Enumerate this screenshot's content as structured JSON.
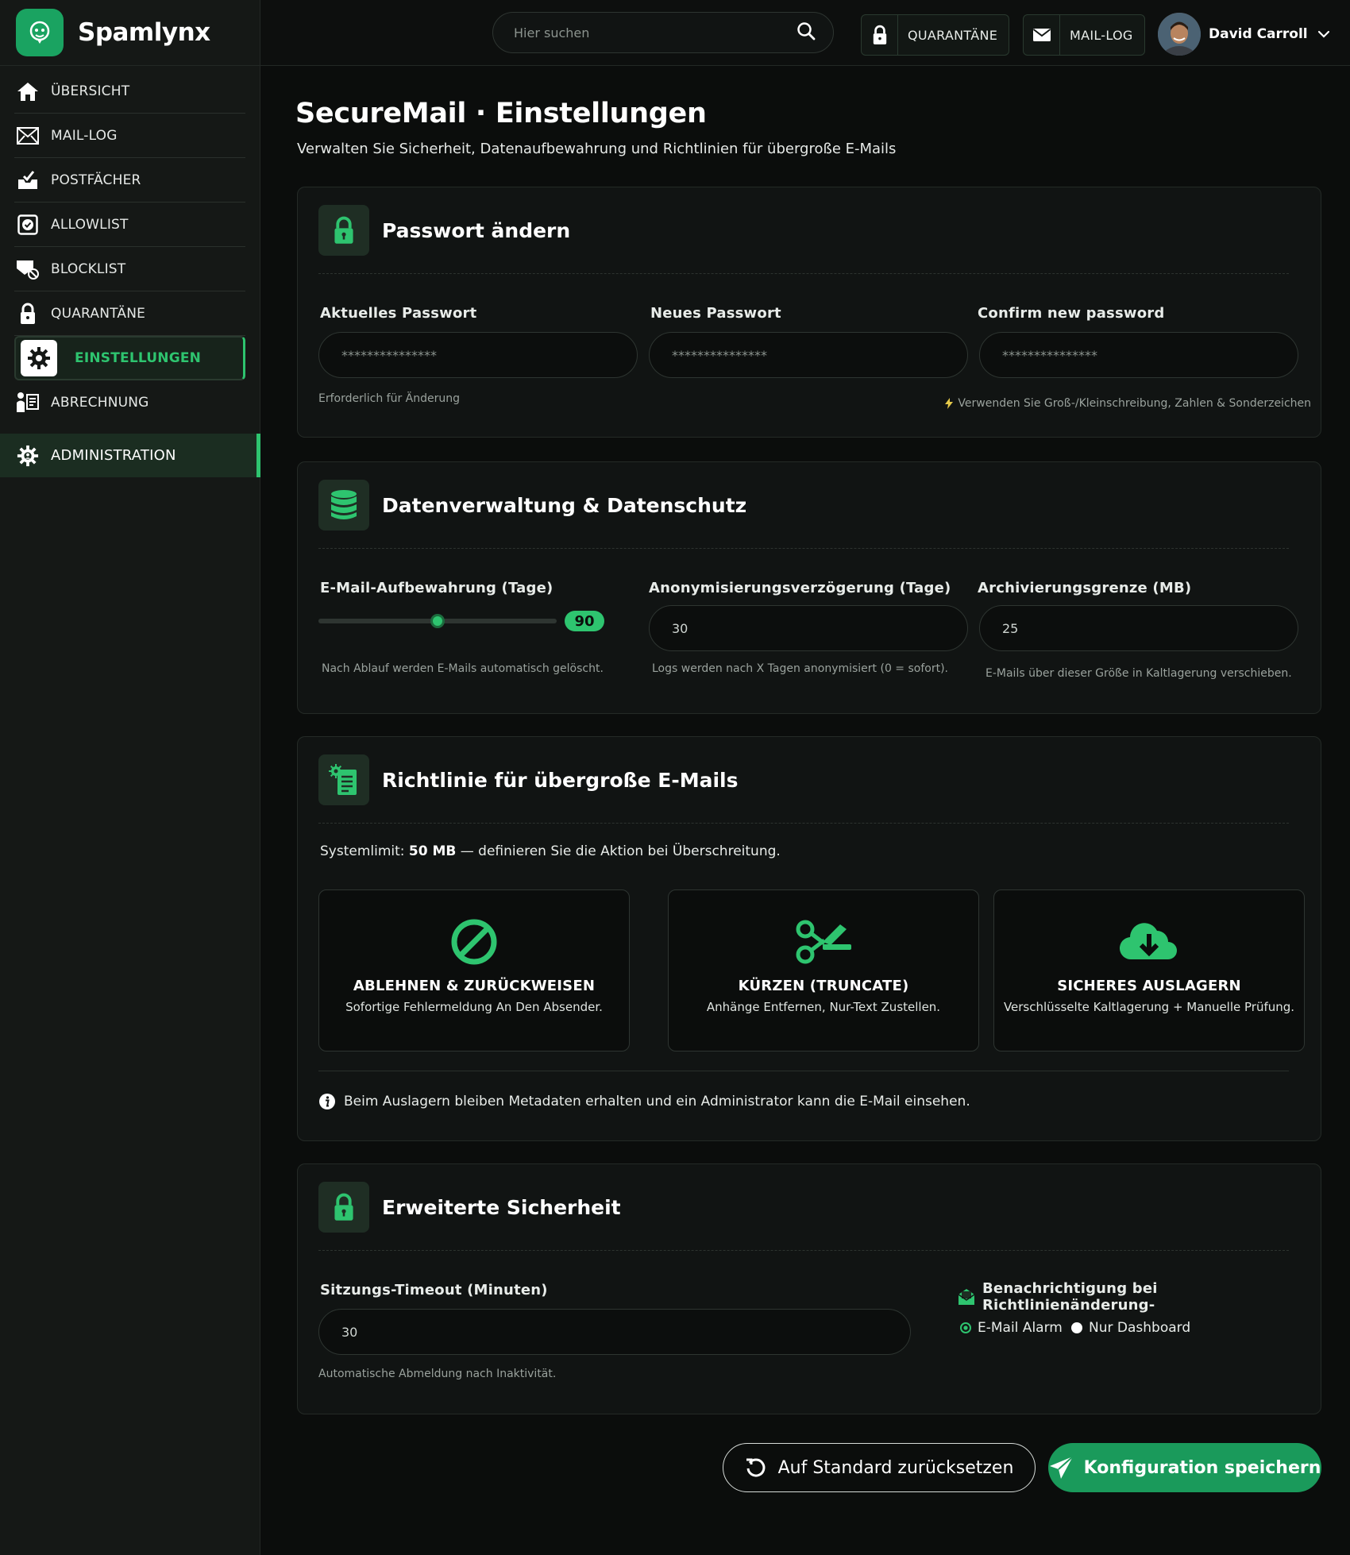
{
  "brand": {
    "name": "Spamlynx"
  },
  "colors": {
    "accent": "#2ec46f",
    "accent_dark": "#1a9a5b",
    "background": "#0b0d0c",
    "card": "#111413"
  },
  "sidebar": {
    "items": [
      {
        "label": "ÜBERSICHT",
        "icon": "home-icon"
      },
      {
        "label": "MAIL-LOG",
        "icon": "mail-log-icon"
      },
      {
        "label": "POSTFÄCHER",
        "icon": "inbox-icon"
      },
      {
        "label": "ALLOWLIST",
        "icon": "check-square-icon"
      },
      {
        "label": "BLOCKLIST",
        "icon": "mail-block-icon"
      },
      {
        "label": "QUARANTÄNE",
        "icon": "lock-icon"
      },
      {
        "label": "EINSTELLUNGEN",
        "icon": "gear-icon",
        "active": true
      },
      {
        "label": "ABRECHNUNG",
        "icon": "billing-icon"
      }
    ],
    "admin": {
      "label": "ADMINISTRATION",
      "icon": "admin-gear-icon"
    }
  },
  "topbar": {
    "search_placeholder": "Hier suchen",
    "quarantine_label": "QUARANTÄNE",
    "maillog_label": "MAIL-LOG",
    "user_name": "David Carroll"
  },
  "page": {
    "title": "SecureMail · Einstellungen",
    "subtitle": "Verwalten Sie Sicherheit, Datenaufbewahrung und Richtlinien für übergroße E-Mails"
  },
  "password": {
    "title": "Passwort ändern",
    "current_label": "Aktuelles Passwort",
    "new_label": "Neues Passwort",
    "confirm_label": "Confirm new password",
    "mask": "***************",
    "hint_required": "Erforderlich für Änderung",
    "hint_rules": "Verwenden Sie Groß-/Kleinschreibung, Zahlen & Sonderzeichen"
  },
  "data_mgmt": {
    "title": "Datenverwaltung & Datenschutz",
    "retention_label": "E-Mail-Aufbewahrung (Tage)",
    "retention_value": 90,
    "retention_min": 0,
    "retention_max": 180,
    "retention_hint": "Nach Ablauf werden E-Mails automatisch gelöscht.",
    "anon_label": "Anonymisierungsverzögerung (Tage)",
    "anon_value": "30",
    "anon_hint": "Logs werden nach X Tagen anonymisiert (0 = sofort).",
    "archive_label": "Archivierungsgrenze (MB)",
    "archive_value": "25",
    "archive_hint": "E-Mails über dieser Größe in Kaltlagerung verschieben."
  },
  "oversize": {
    "title": "Richtlinie für übergroße E-Mails",
    "limit_prefix": "Systemlimit: ",
    "limit_value": "50 MB",
    "limit_suffix": " — definieren Sie die Aktion bei Überschreitung.",
    "options": [
      {
        "title": "ABLEHNEN & ZURÜCKWEISEN",
        "desc": "Sofortige Fehlermeldung An Den Absender.",
        "icon": "ban-icon"
      },
      {
        "title": "KÜRZEN (TRUNCATE)",
        "desc": "Anhänge Entfernen, Nur-Text Zustellen.",
        "icon": "scissors-icon"
      },
      {
        "title": "SICHERES AUSLAGERN",
        "desc": "Verschlüsselte Kaltlagerung + Manuelle Prüfung.",
        "icon": "cloud-download-icon"
      }
    ],
    "info": "Beim Auslagern bleiben Metadaten erhalten und ein Administrator kann die E-Mail einsehen."
  },
  "advanced": {
    "title": "Erweiterte Sicherheit",
    "timeout_label": "Sitzungs-Timeout (Minuten)",
    "timeout_value": "30",
    "timeout_hint": "Automatische Abmeldung nach Inaktivität.",
    "notify_label": "Benachrichtigung bei Richtlinienänderung-",
    "radio_email": "E-Mail Alarm",
    "radio_dashboard": "Nur Dashboard"
  },
  "actions": {
    "reset_label": "Auf Standard zurücksetzen",
    "save_label": "Konfiguration speichern"
  }
}
